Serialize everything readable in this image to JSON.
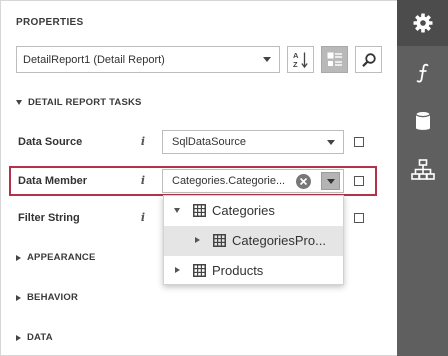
{
  "panel": {
    "title": "PROPERTIES",
    "component_select": "DetailReport1 (Detail Report)"
  },
  "sidebar": {
    "items": [
      {
        "icon": "gear-icon",
        "active": true
      },
      {
        "icon": "function-icon",
        "active": false
      },
      {
        "icon": "database-icon",
        "active": false
      },
      {
        "icon": "hierarchy-icon",
        "active": false
      }
    ]
  },
  "toolbar": {
    "sort_icon": "sort-alphabetical-icon",
    "categories_icon": "categorized-view-icon",
    "search_icon": "search-icon"
  },
  "tasks_section": {
    "label": "DETAIL REPORT TASKS",
    "properties": [
      {
        "label": "Data Source",
        "value": "SqlDataSource"
      },
      {
        "label": "Data Member",
        "value": "Categories.Categorie..."
      },
      {
        "label": "Filter String",
        "value": ""
      }
    ],
    "info_glyph": "i"
  },
  "tree_dropdown": {
    "items": [
      {
        "label": "Categories",
        "expanded": true,
        "level": 0
      },
      {
        "label": "CategoriesPro...",
        "expanded": false,
        "level": 1,
        "selected": true
      },
      {
        "label": "Products",
        "expanded": false,
        "level": 0
      }
    ]
  },
  "collapsed_sections": [
    {
      "label": "APPEARANCE"
    },
    {
      "label": "BEHAVIOR"
    },
    {
      "label": "DATA"
    }
  ],
  "colors": {
    "sidebar_bg": "#5f5f5f",
    "highlight_border": "#b3324a",
    "pressed_button": "#b9b9b9"
  }
}
